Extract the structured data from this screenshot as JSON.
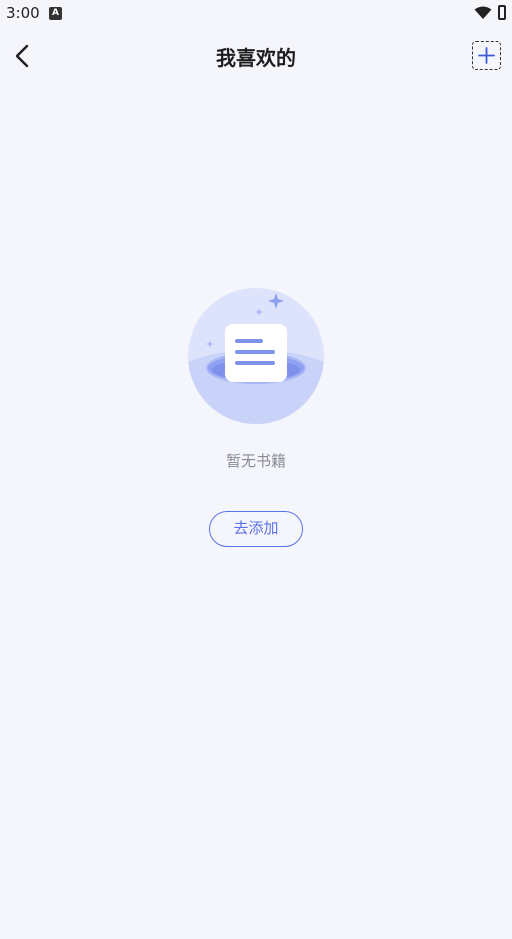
{
  "status_bar": {
    "time": "3:00",
    "notification_icon": "a-icon",
    "wifi_icon": "wifi-icon",
    "battery_icon": "battery-charging-icon"
  },
  "app_bar": {
    "title": "我喜欢的",
    "back_icon": "chevron-left-icon",
    "add_icon": "plus-icon"
  },
  "empty_state": {
    "illustration": "empty-document-illustration",
    "message": "暂无书籍",
    "action_label": "去添加"
  },
  "colors": {
    "background": "#F5F5FC",
    "accent": "#5B72E6",
    "muted_text": "#8A8A92",
    "title_text": "#1E1E1E",
    "illustration_circle": "#DDE3FB",
    "illustration_ring": "#A9B7F5"
  }
}
